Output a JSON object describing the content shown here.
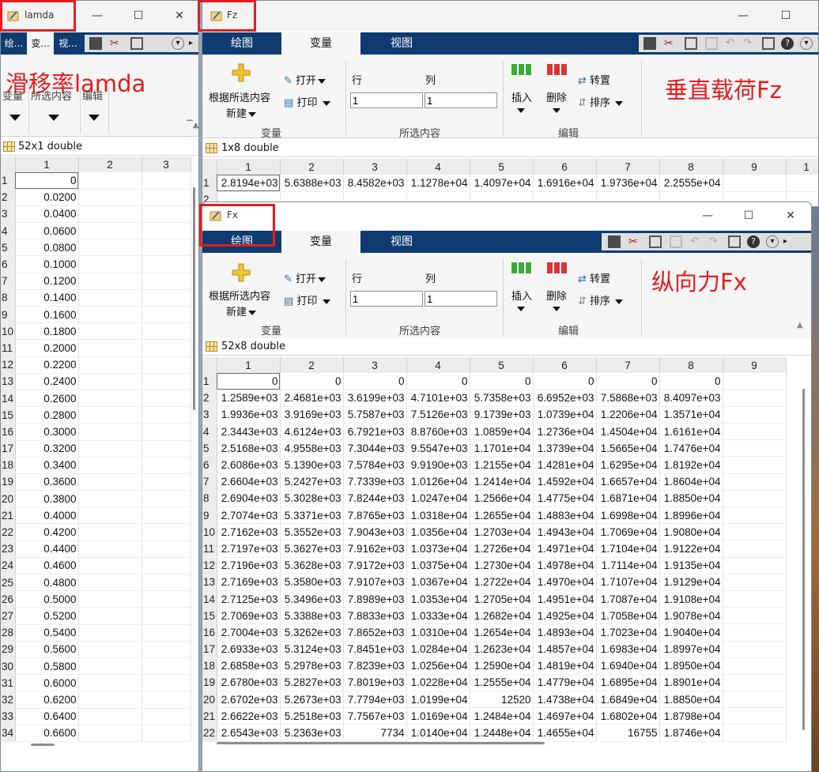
{
  "colors": {
    "annotation": "#e41d1d",
    "tabbar": "#0f3b71"
  },
  "lamda": {
    "title": "lamda",
    "tabs": [
      "绘...",
      "变...",
      "视..."
    ],
    "annotation": "滑移率lamda",
    "ribbon": {
      "var": "变量",
      "sel": "所选内容",
      "edit": "编辑"
    },
    "info": "52x1 double",
    "col_headers": [
      "1",
      "2",
      "3"
    ],
    "rows": [
      [
        "1",
        "0"
      ],
      [
        "2",
        "0.0200"
      ],
      [
        "3",
        "0.0400"
      ],
      [
        "4",
        "0.0600"
      ],
      [
        "5",
        "0.0800"
      ],
      [
        "6",
        "0.1000"
      ],
      [
        "7",
        "0.1200"
      ],
      [
        "8",
        "0.1400"
      ],
      [
        "9",
        "0.1600"
      ],
      [
        "10",
        "0.1800"
      ],
      [
        "11",
        "0.2000"
      ],
      [
        "12",
        "0.2200"
      ],
      [
        "13",
        "0.2400"
      ],
      [
        "14",
        "0.2600"
      ],
      [
        "15",
        "0.2800"
      ],
      [
        "16",
        "0.3000"
      ],
      [
        "17",
        "0.3200"
      ],
      [
        "18",
        "0.3400"
      ],
      [
        "19",
        "0.3600"
      ],
      [
        "20",
        "0.3800"
      ],
      [
        "21",
        "0.4000"
      ],
      [
        "22",
        "0.4200"
      ],
      [
        "23",
        "0.4400"
      ],
      [
        "24",
        "0.4600"
      ],
      [
        "25",
        "0.4800"
      ],
      [
        "26",
        "0.5000"
      ],
      [
        "27",
        "0.5200"
      ],
      [
        "28",
        "0.5400"
      ],
      [
        "29",
        "0.5600"
      ],
      [
        "30",
        "0.5800"
      ],
      [
        "31",
        "0.6000"
      ],
      [
        "32",
        "0.6200"
      ],
      [
        "33",
        "0.6400"
      ],
      [
        "34",
        "0.6600"
      ]
    ]
  },
  "fz": {
    "title": "Fz",
    "tabs": [
      "绘图",
      "变量",
      "视图"
    ],
    "annotation": "垂直载荷Fz",
    "ribbon": {
      "new_line1": "根据所选内容",
      "new_line2": "新建",
      "open": "打开",
      "print": "打印",
      "row_label": "行",
      "col_label": "列",
      "row_value": "1",
      "col_value": "1",
      "insert": "插入",
      "delete": "删除",
      "transpose": "转置",
      "sort": "排序",
      "sec_var": "变量",
      "sec_sel": "所选内容",
      "sec_edit": "编辑"
    },
    "info": "1x8 double",
    "col_headers": [
      "1",
      "2",
      "3",
      "4",
      "5",
      "6",
      "7",
      "8",
      "9",
      "1"
    ],
    "rows": [
      [
        "1",
        "2.8194e+03",
        "5.6388e+03",
        "8.4582e+03",
        "1.1278e+04",
        "1.4097e+04",
        "1.6916e+04",
        "1.9736e+04",
        "2.2555e+04",
        ""
      ],
      [
        "2",
        "",
        "",
        "",
        "",
        "",
        "",
        "",
        "",
        ""
      ]
    ]
  },
  "fx": {
    "title": "Fx",
    "tabs": [
      "绘图",
      "变量",
      "视图"
    ],
    "annotation": "纵向力Fx",
    "ribbon": {
      "new_line1": "根据所选内容",
      "new_line2": "新建",
      "open": "打开",
      "print": "打印",
      "row_label": "行",
      "col_label": "列",
      "row_value": "1",
      "col_value": "1",
      "insert": "插入",
      "delete": "删除",
      "transpose": "转置",
      "sort": "排序",
      "sec_var": "变量",
      "sec_sel": "所选内容",
      "sec_edit": "编辑"
    },
    "info": "52x8 double",
    "col_headers": [
      "1",
      "2",
      "3",
      "4",
      "5",
      "6",
      "7",
      "8",
      "9"
    ],
    "rows": [
      [
        "1",
        "0",
        "0",
        "0",
        "0",
        "0",
        "0",
        "0",
        "0",
        ""
      ],
      [
        "2",
        "1.2589e+03",
        "2.4681e+03",
        "3.6199e+03",
        "4.7101e+03",
        "5.7358e+03",
        "6.6952e+03",
        "7.5868e+03",
        "8.4097e+03",
        ""
      ],
      [
        "3",
        "1.9936e+03",
        "3.9169e+03",
        "5.7587e+03",
        "7.5126e+03",
        "9.1739e+03",
        "1.0739e+04",
        "1.2206e+04",
        "1.3571e+04",
        ""
      ],
      [
        "4",
        "2.3443e+03",
        "4.6124e+03",
        "6.7921e+03",
        "8.8760e+03",
        "1.0859e+04",
        "1.2736e+04",
        "1.4504e+04",
        "1.6161e+04",
        ""
      ],
      [
        "5",
        "2.5168e+03",
        "4.9558e+03",
        "7.3044e+03",
        "9.5547e+03",
        "1.1701e+04",
        "1.3739e+04",
        "1.5665e+04",
        "1.7476e+04",
        ""
      ],
      [
        "6",
        "2.6086e+03",
        "5.1390e+03",
        "7.5784e+03",
        "9.9190e+03",
        "1.2155e+04",
        "1.4281e+04",
        "1.6295e+04",
        "1.8192e+04",
        ""
      ],
      [
        "7",
        "2.6604e+03",
        "5.2427e+03",
        "7.7339e+03",
        "1.0126e+04",
        "1.2414e+04",
        "1.4592e+04",
        "1.6657e+04",
        "1.8604e+04",
        ""
      ],
      [
        "8",
        "2.6904e+03",
        "5.3028e+03",
        "7.8244e+03",
        "1.0247e+04",
        "1.2566e+04",
        "1.4775e+04",
        "1.6871e+04",
        "1.8850e+04",
        ""
      ],
      [
        "9",
        "2.7074e+03",
        "5.3371e+03",
        "7.8765e+03",
        "1.0318e+04",
        "1.2655e+04",
        "1.4883e+04",
        "1.6998e+04",
        "1.8996e+04",
        ""
      ],
      [
        "10",
        "2.7162e+03",
        "5.3552e+03",
        "7.9043e+03",
        "1.0356e+04",
        "1.2703e+04",
        "1.4943e+04",
        "1.7069e+04",
        "1.9080e+04",
        ""
      ],
      [
        "11",
        "2.7197e+03",
        "5.3627e+03",
        "7.9162e+03",
        "1.0373e+04",
        "1.2726e+04",
        "1.4971e+04",
        "1.7104e+04",
        "1.9122e+04",
        ""
      ],
      [
        "12",
        "2.7196e+03",
        "5.3628e+03",
        "7.9172e+03",
        "1.0375e+04",
        "1.2730e+04",
        "1.4978e+04",
        "1.7114e+04",
        "1.9135e+04",
        ""
      ],
      [
        "13",
        "2.7169e+03",
        "5.3580e+03",
        "7.9107e+03",
        "1.0367e+04",
        "1.2722e+04",
        "1.4970e+04",
        "1.7107e+04",
        "1.9129e+04",
        ""
      ],
      [
        "14",
        "2.7125e+03",
        "5.3496e+03",
        "7.8989e+03",
        "1.0353e+04",
        "1.2705e+04",
        "1.4951e+04",
        "1.7087e+04",
        "1.9108e+04",
        ""
      ],
      [
        "15",
        "2.7069e+03",
        "5.3388e+03",
        "7.8833e+03",
        "1.0333e+04",
        "1.2682e+04",
        "1.4925e+04",
        "1.7058e+04",
        "1.9078e+04",
        ""
      ],
      [
        "16",
        "2.7004e+03",
        "5.3262e+03",
        "7.8652e+03",
        "1.0310e+04",
        "1.2654e+04",
        "1.4893e+04",
        "1.7023e+04",
        "1.9040e+04",
        ""
      ],
      [
        "17",
        "2.6933e+03",
        "5.3124e+03",
        "7.8451e+03",
        "1.0284e+04",
        "1.2623e+04",
        "1.4857e+04",
        "1.6983e+04",
        "1.8997e+04",
        ""
      ],
      [
        "18",
        "2.6858e+03",
        "5.2978e+03",
        "7.8239e+03",
        "1.0256e+04",
        "1.2590e+04",
        "1.4819e+04",
        "1.6940e+04",
        "1.8950e+04",
        ""
      ],
      [
        "19",
        "2.6780e+03",
        "5.2827e+03",
        "7.8019e+03",
        "1.0228e+04",
        "1.2555e+04",
        "1.4779e+04",
        "1.6895e+04",
        "1.8901e+04",
        ""
      ],
      [
        "20",
        "2.6702e+03",
        "5.2673e+03",
        "7.7794e+03",
        "1.0199e+04",
        "12520",
        "1.4738e+04",
        "1.6849e+04",
        "1.8850e+04",
        ""
      ],
      [
        "21",
        "2.6622e+03",
        "5.2518e+03",
        "7.7567e+03",
        "1.0169e+04",
        "1.2484e+04",
        "1.4697e+04",
        "1.6802e+04",
        "1.8798e+04",
        ""
      ],
      [
        "22",
        "2.6543e+03",
        "5.2363e+03",
        "7734",
        "1.0140e+04",
        "1.2448e+04",
        "1.4655e+04",
        "16755",
        "1.8746e+04",
        ""
      ]
    ]
  }
}
